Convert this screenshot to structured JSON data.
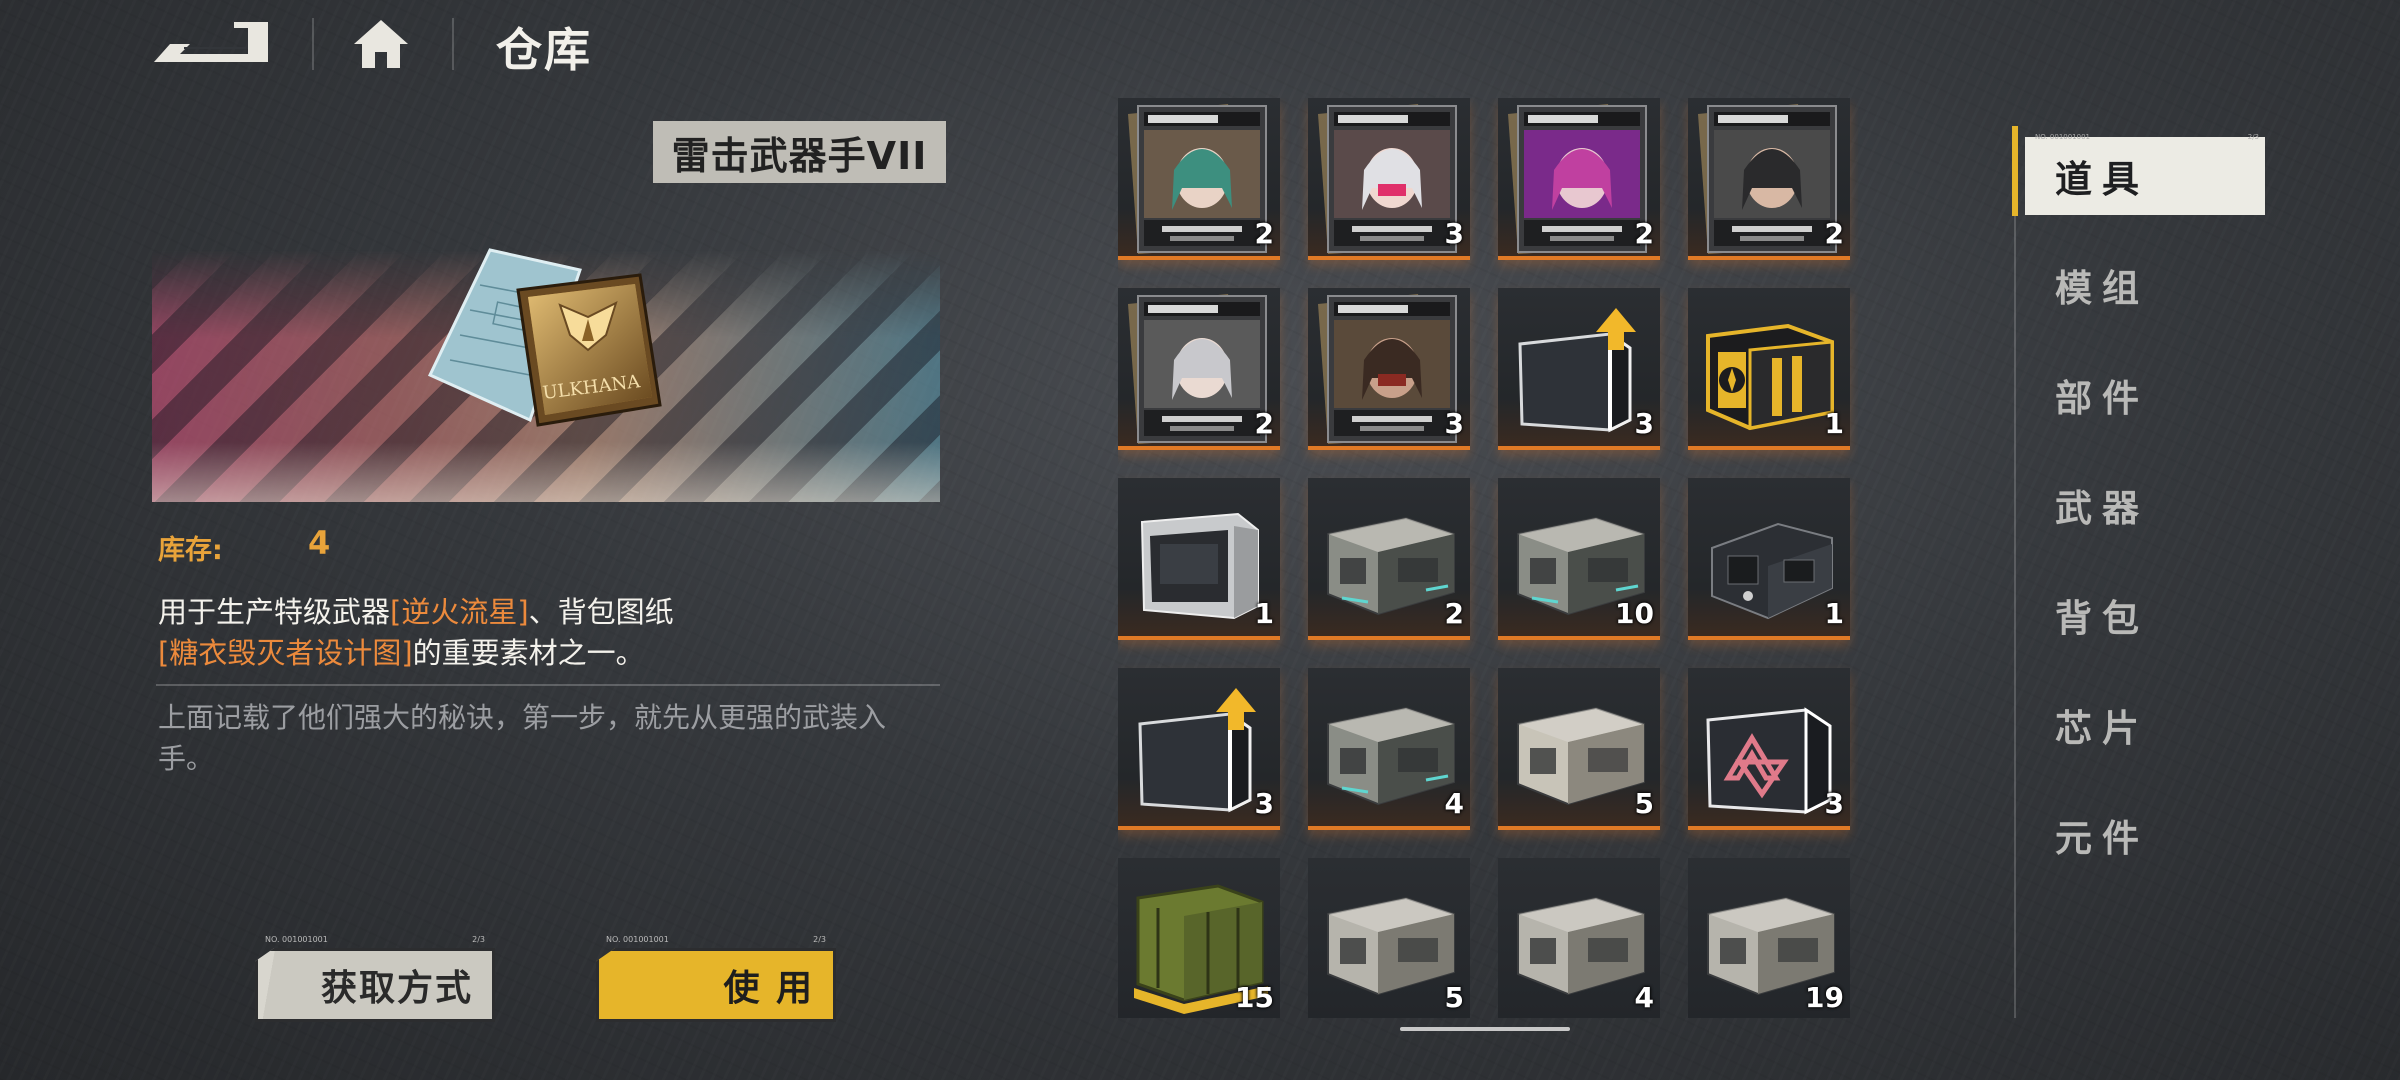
{
  "header": {
    "back_icon": "back-arrow-icon",
    "home_icon": "home-icon",
    "title": "仓库"
  },
  "detail": {
    "item_name": "雷击武器手VII",
    "item_art_text": "ULKHANA",
    "stock_label": "库存:",
    "stock_value": "4",
    "desc_part1": "用于生产特级武器",
    "desc_hl1": "[逆火流星]",
    "desc_part2": "、背包图纸",
    "desc_hl2": "[糖衣毁灭者设计图]",
    "desc_part3": "的重要素材之一。",
    "lore": "上面记载了他们强大的秘诀，第一步，就先从更强的武装入手。",
    "source_button": "获取方式",
    "use_button": "使 用",
    "button_micro_left": "NO. 001001001",
    "button_micro_right": "2/3"
  },
  "grid": {
    "items": [
      {
        "kind": "magazine",
        "count": "2",
        "art": "cyan"
      },
      {
        "kind": "magazine",
        "count": "3",
        "art": "pink"
      },
      {
        "kind": "magazine",
        "count": "2",
        "art": "purple"
      },
      {
        "kind": "magazine",
        "count": "2",
        "art": "man"
      },
      {
        "kind": "magazine",
        "count": "2",
        "art": "silver"
      },
      {
        "kind": "magazine",
        "count": "3",
        "art": "mask"
      },
      {
        "kind": "box-up",
        "count": "3"
      },
      {
        "kind": "chest-gold",
        "count": "1"
      },
      {
        "kind": "box-white",
        "count": "1"
      },
      {
        "kind": "crate-metal",
        "count": "2"
      },
      {
        "kind": "crate-metal",
        "count": "10"
      },
      {
        "kind": "crate-dark",
        "count": "1"
      },
      {
        "kind": "box-up",
        "count": "3"
      },
      {
        "kind": "crate-metal",
        "count": "4"
      },
      {
        "kind": "crate-light",
        "count": "5"
      },
      {
        "kind": "box-logo",
        "count": "3"
      },
      {
        "kind": "crate-green",
        "count": "15"
      },
      {
        "kind": "crate-grey",
        "count": "5"
      },
      {
        "kind": "crate-grey",
        "count": "4"
      },
      {
        "kind": "crate-grey",
        "count": "19"
      }
    ]
  },
  "tabs": {
    "items": [
      {
        "label": "道具",
        "active": true
      },
      {
        "label": "模组",
        "active": false
      },
      {
        "label": "部件",
        "active": false
      },
      {
        "label": "武器",
        "active": false
      },
      {
        "label": "背包",
        "active": false
      },
      {
        "label": "芯片",
        "active": false
      },
      {
        "label": "元件",
        "active": false
      }
    ],
    "micro_left": "NO. 001001001",
    "micro_right": "2/3"
  },
  "colors": {
    "accent_yellow": "#e6b52a",
    "highlight_orange": "#ec8a3c",
    "rarity_orange": "#e07a26"
  }
}
